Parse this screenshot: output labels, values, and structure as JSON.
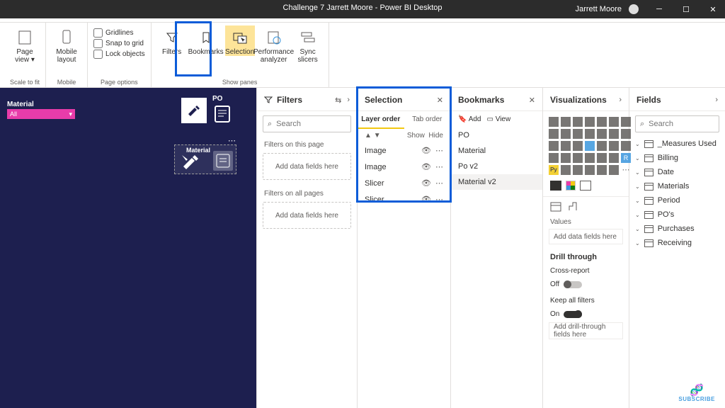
{
  "titlebar": {
    "title": "Challenge 7 Jarrett Moore - Power BI Desktop",
    "user": "Jarrett Moore"
  },
  "ribbon": {
    "page_view": "Page view ▾",
    "mobile_layout": "Mobile layout",
    "gridlines": "Gridlines",
    "snap": "Snap to grid",
    "lock": "Lock objects",
    "filters": "Filters",
    "bookmarks": "Bookmarks",
    "selection": "Selection",
    "perf": "Performance analyzer",
    "sync": "Sync slicers",
    "g_scale": "Scale to fit",
    "g_mobile": "Mobile",
    "g_page": "Page options",
    "g_show": "Show panes"
  },
  "canvas": {
    "material": "Material",
    "all": "All",
    "po": "PO"
  },
  "filters": {
    "title": "Filters",
    "search_ph": "Search",
    "on_page": "Filters on this page",
    "on_all": "Filters on all pages",
    "drop": "Add data fields here"
  },
  "selection": {
    "title": "Selection",
    "layer": "Layer order",
    "tab": "Tab order",
    "show": "Show",
    "hide": "Hide",
    "items": [
      "Image",
      "Image",
      "Slicer",
      "Slicer"
    ]
  },
  "bookmarks": {
    "title": "Bookmarks",
    "add": "Add",
    "view": "View",
    "items": [
      "PO",
      "Material",
      "Po v2",
      "Material v2"
    ]
  },
  "viz": {
    "title": "Visualizations",
    "values": "Values",
    "drop": "Add data fields here",
    "drill": "Drill through",
    "cross": "Cross-report",
    "off": "Off",
    "keep": "Keep all filters",
    "on": "On",
    "drill_drop": "Add drill-through fields here"
  },
  "fields": {
    "title": "Fields",
    "search_ph": "Search",
    "tables": [
      "_Measures Used",
      "Billing",
      "Date",
      "Materials",
      "Period",
      "PO's",
      "Purchases",
      "Receiving"
    ]
  },
  "subscribe": "SUBSCRIBE"
}
